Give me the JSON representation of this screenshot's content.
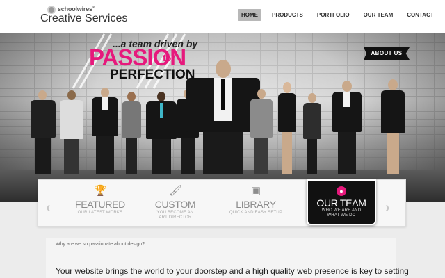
{
  "header": {
    "logo_small": "schoolwires",
    "logo_reg": "®",
    "logo_big": "Creative Services"
  },
  "nav": [
    {
      "label": "HOME",
      "active": true
    },
    {
      "label": "PRODUCTS",
      "active": false
    },
    {
      "label": "PORTFOLIO",
      "active": false
    },
    {
      "label": "OUR TEAM",
      "active": false
    },
    {
      "label": "CONTACT",
      "active": false
    }
  ],
  "hero": {
    "tagline_top": "...a team driven by",
    "tagline_passion": "PASSION",
    "tagline_for": "for",
    "tagline_perfection": "PERFECTION",
    "about_tab": "ABOUT US"
  },
  "features": [
    {
      "icon": "trophy-icon",
      "glyph": "🏆",
      "title": "FEATURED",
      "sub": "OUR LATEST WORKS"
    },
    {
      "icon": "brush-icon",
      "glyph": "🖌",
      "title": "CUSTOM",
      "sub": "YOU BECOME AN ART DIRECTOR"
    },
    {
      "icon": "library-icon",
      "glyph": "▣",
      "title": "LIBRARY",
      "sub": "QUICK AND EASY SETUP"
    },
    {
      "icon": "team-icon",
      "glyph": "●",
      "title": "OUR TEAM",
      "sub": "WHO WE ARE AND WHAT WE DO"
    }
  ],
  "arrows": {
    "left": "‹",
    "right": "›"
  },
  "content": {
    "question": "Why are we so passionate about design?",
    "lead": "Your website brings the world to your doorstep and a high quality web presence is key to setting"
  },
  "colors": {
    "accent": "#e6197c",
    "dark": "#111111"
  }
}
